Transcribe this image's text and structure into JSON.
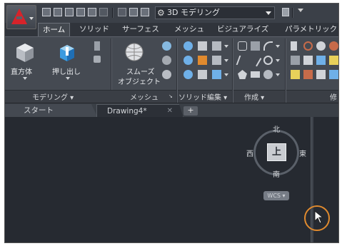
{
  "quick_access": {
    "workspace": "3D モデリング",
    "workspace_icon": "gear-icon"
  },
  "ribbon_tabs": [
    "ホーム",
    "ソリッド",
    "サーフェス",
    "メッシュ",
    "ビジュアライズ",
    "パラメトリック"
  ],
  "ribbon": {
    "modeling": {
      "box_label": "直方体",
      "extrude_label": "押し出し",
      "title": "モデリング ▾"
    },
    "mesh": {
      "smooth_label_1": "スムーズ",
      "smooth_label_2": "オブジェクト",
      "title": "メッシュ"
    },
    "solid_edit": {
      "title": "ソリッド編集 ▾"
    },
    "draw": {
      "title": "作成 ▾"
    },
    "modify": {
      "title": "修"
    }
  },
  "file_tabs": {
    "start": "スタート",
    "drawing": "Drawing4*",
    "close_symbol": "✕",
    "new_symbol": "+"
  },
  "viewcube": {
    "north": "北",
    "south": "南",
    "east": "東",
    "west": "西",
    "top": "上",
    "wcs": "WCS ▾"
  },
  "colors": {
    "accent": "#e08a2e",
    "app_logo": "#d7232a",
    "canvas": "#262a31"
  }
}
